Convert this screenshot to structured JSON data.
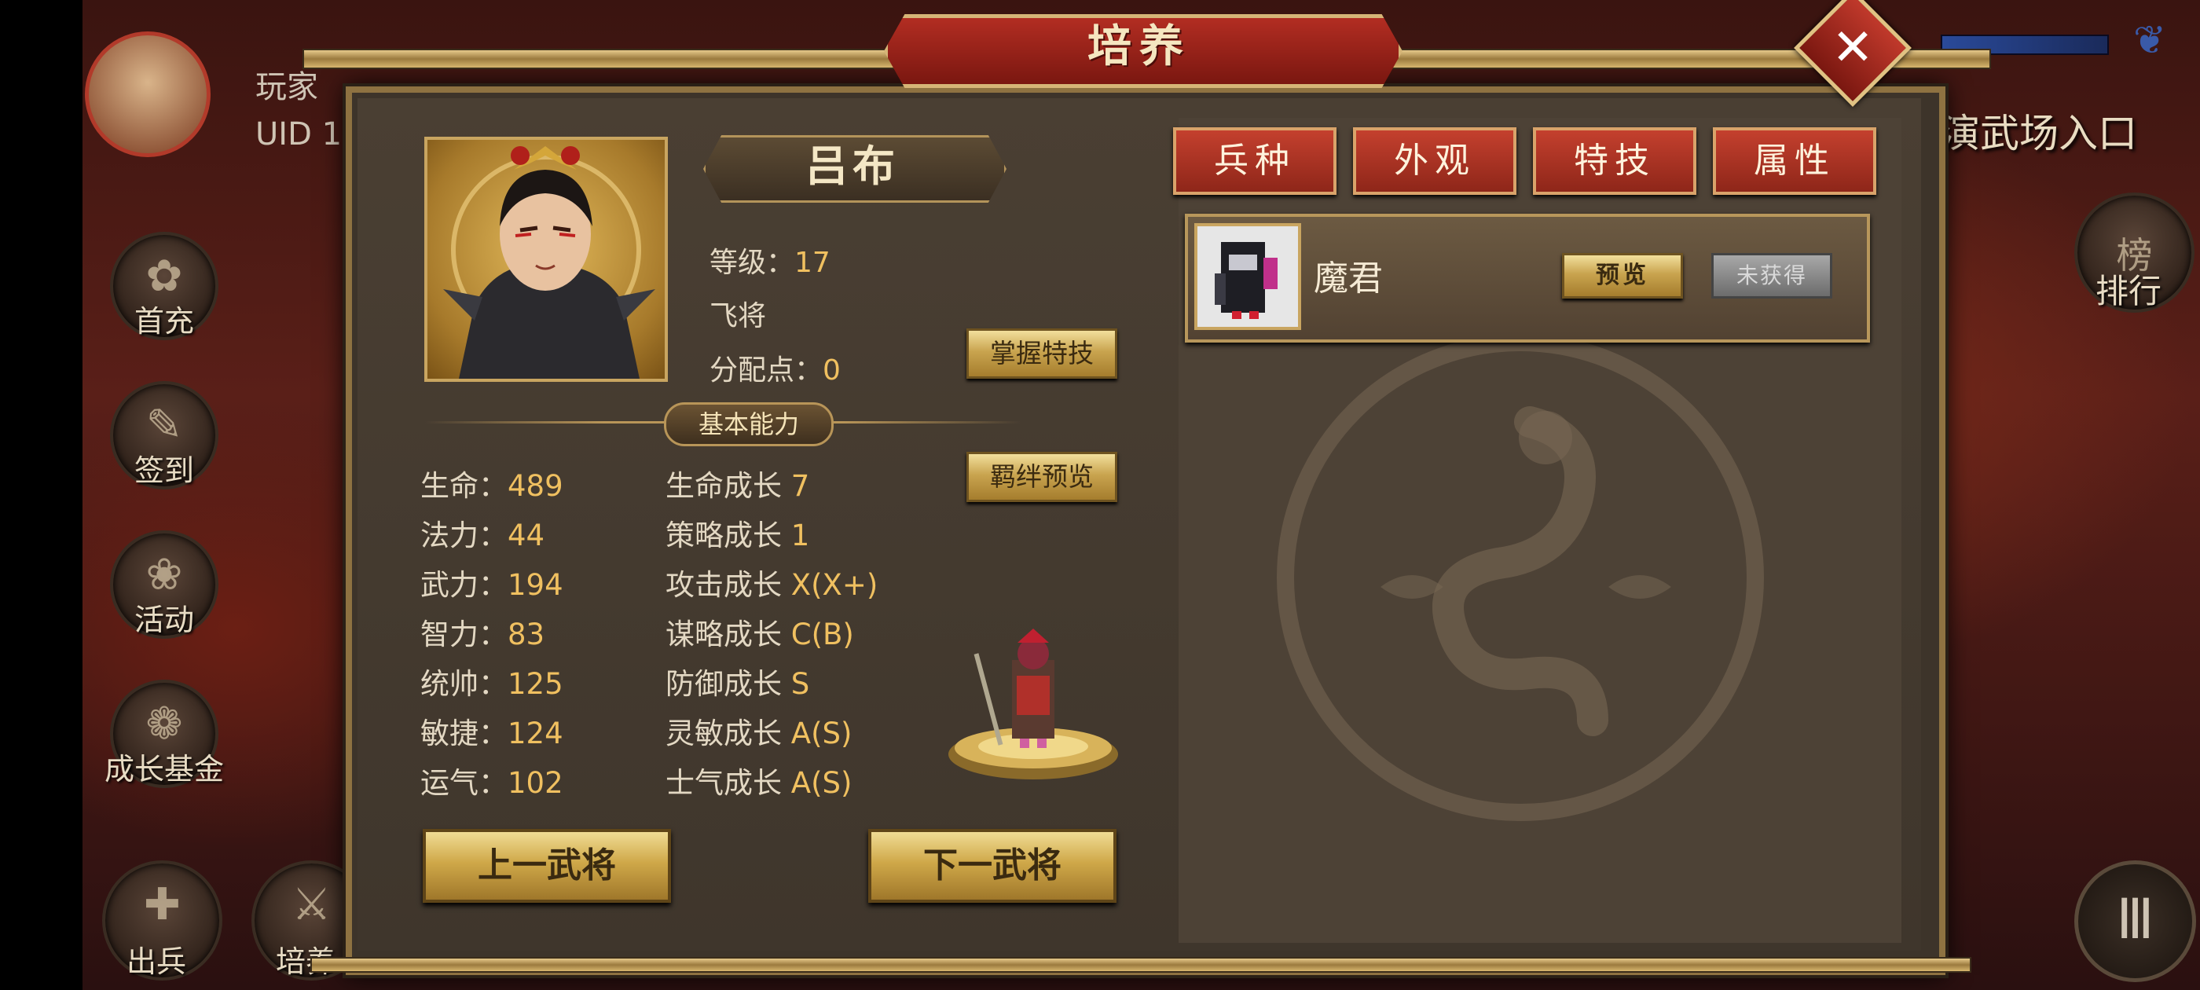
{
  "background": {
    "player_label": "玩家",
    "uid_label": "UID 1",
    "arena_entry": "演武场入口",
    "ranking_label": "排行",
    "ranking_glyph": "榜",
    "left_menu": [
      {
        "label": "首充",
        "icon": "first-charge-icon"
      },
      {
        "label": "签到",
        "icon": "sign-in-icon"
      },
      {
        "label": "活动",
        "icon": "activity-icon"
      },
      {
        "label": "成长基金",
        "icon": "growth-fund-icon"
      }
    ],
    "bottom_menu": [
      {
        "label": "出兵",
        "icon": "dispatch-icon"
      },
      {
        "label": "培养",
        "icon": "train-icon"
      }
    ]
  },
  "dialog": {
    "title": "培养",
    "close_glyph": "✕"
  },
  "hero": {
    "name": "吕布",
    "level_label": "等级：",
    "level_value": "17",
    "unit_type": "飞将",
    "points_label": "分配点：",
    "points_value": "0"
  },
  "actions": {
    "master_skill": "掌握特技",
    "bond_preview": "羁绊预览",
    "prev_general": "上一武将",
    "next_general": "下一武将"
  },
  "abilities": {
    "header": "基本能力",
    "base": [
      {
        "label": "生命：",
        "value": "489"
      },
      {
        "label": "法力：",
        "value": "44"
      },
      {
        "label": "武力：",
        "value": "194"
      },
      {
        "label": "智力：",
        "value": "83"
      },
      {
        "label": "统帅：",
        "value": "125"
      },
      {
        "label": "敏捷：",
        "value": "124"
      },
      {
        "label": "运气：",
        "value": "102"
      }
    ],
    "growth": [
      {
        "label": "生命成长",
        "value": "7"
      },
      {
        "label": "策略成长",
        "value": "1"
      },
      {
        "label": "攻击成长",
        "value": "X(X+)"
      },
      {
        "label": "谋略成长",
        "value": "C(B)"
      },
      {
        "label": "防御成长",
        "value": "S"
      },
      {
        "label": "灵敏成长",
        "value": "A(S)"
      },
      {
        "label": "士气成长",
        "value": "A(S)"
      }
    ]
  },
  "tabs": [
    "兵种",
    "外观",
    "特技",
    "属性"
  ],
  "skin": {
    "name": "魔君",
    "preview_label": "预览",
    "status_label": "未获得"
  }
}
